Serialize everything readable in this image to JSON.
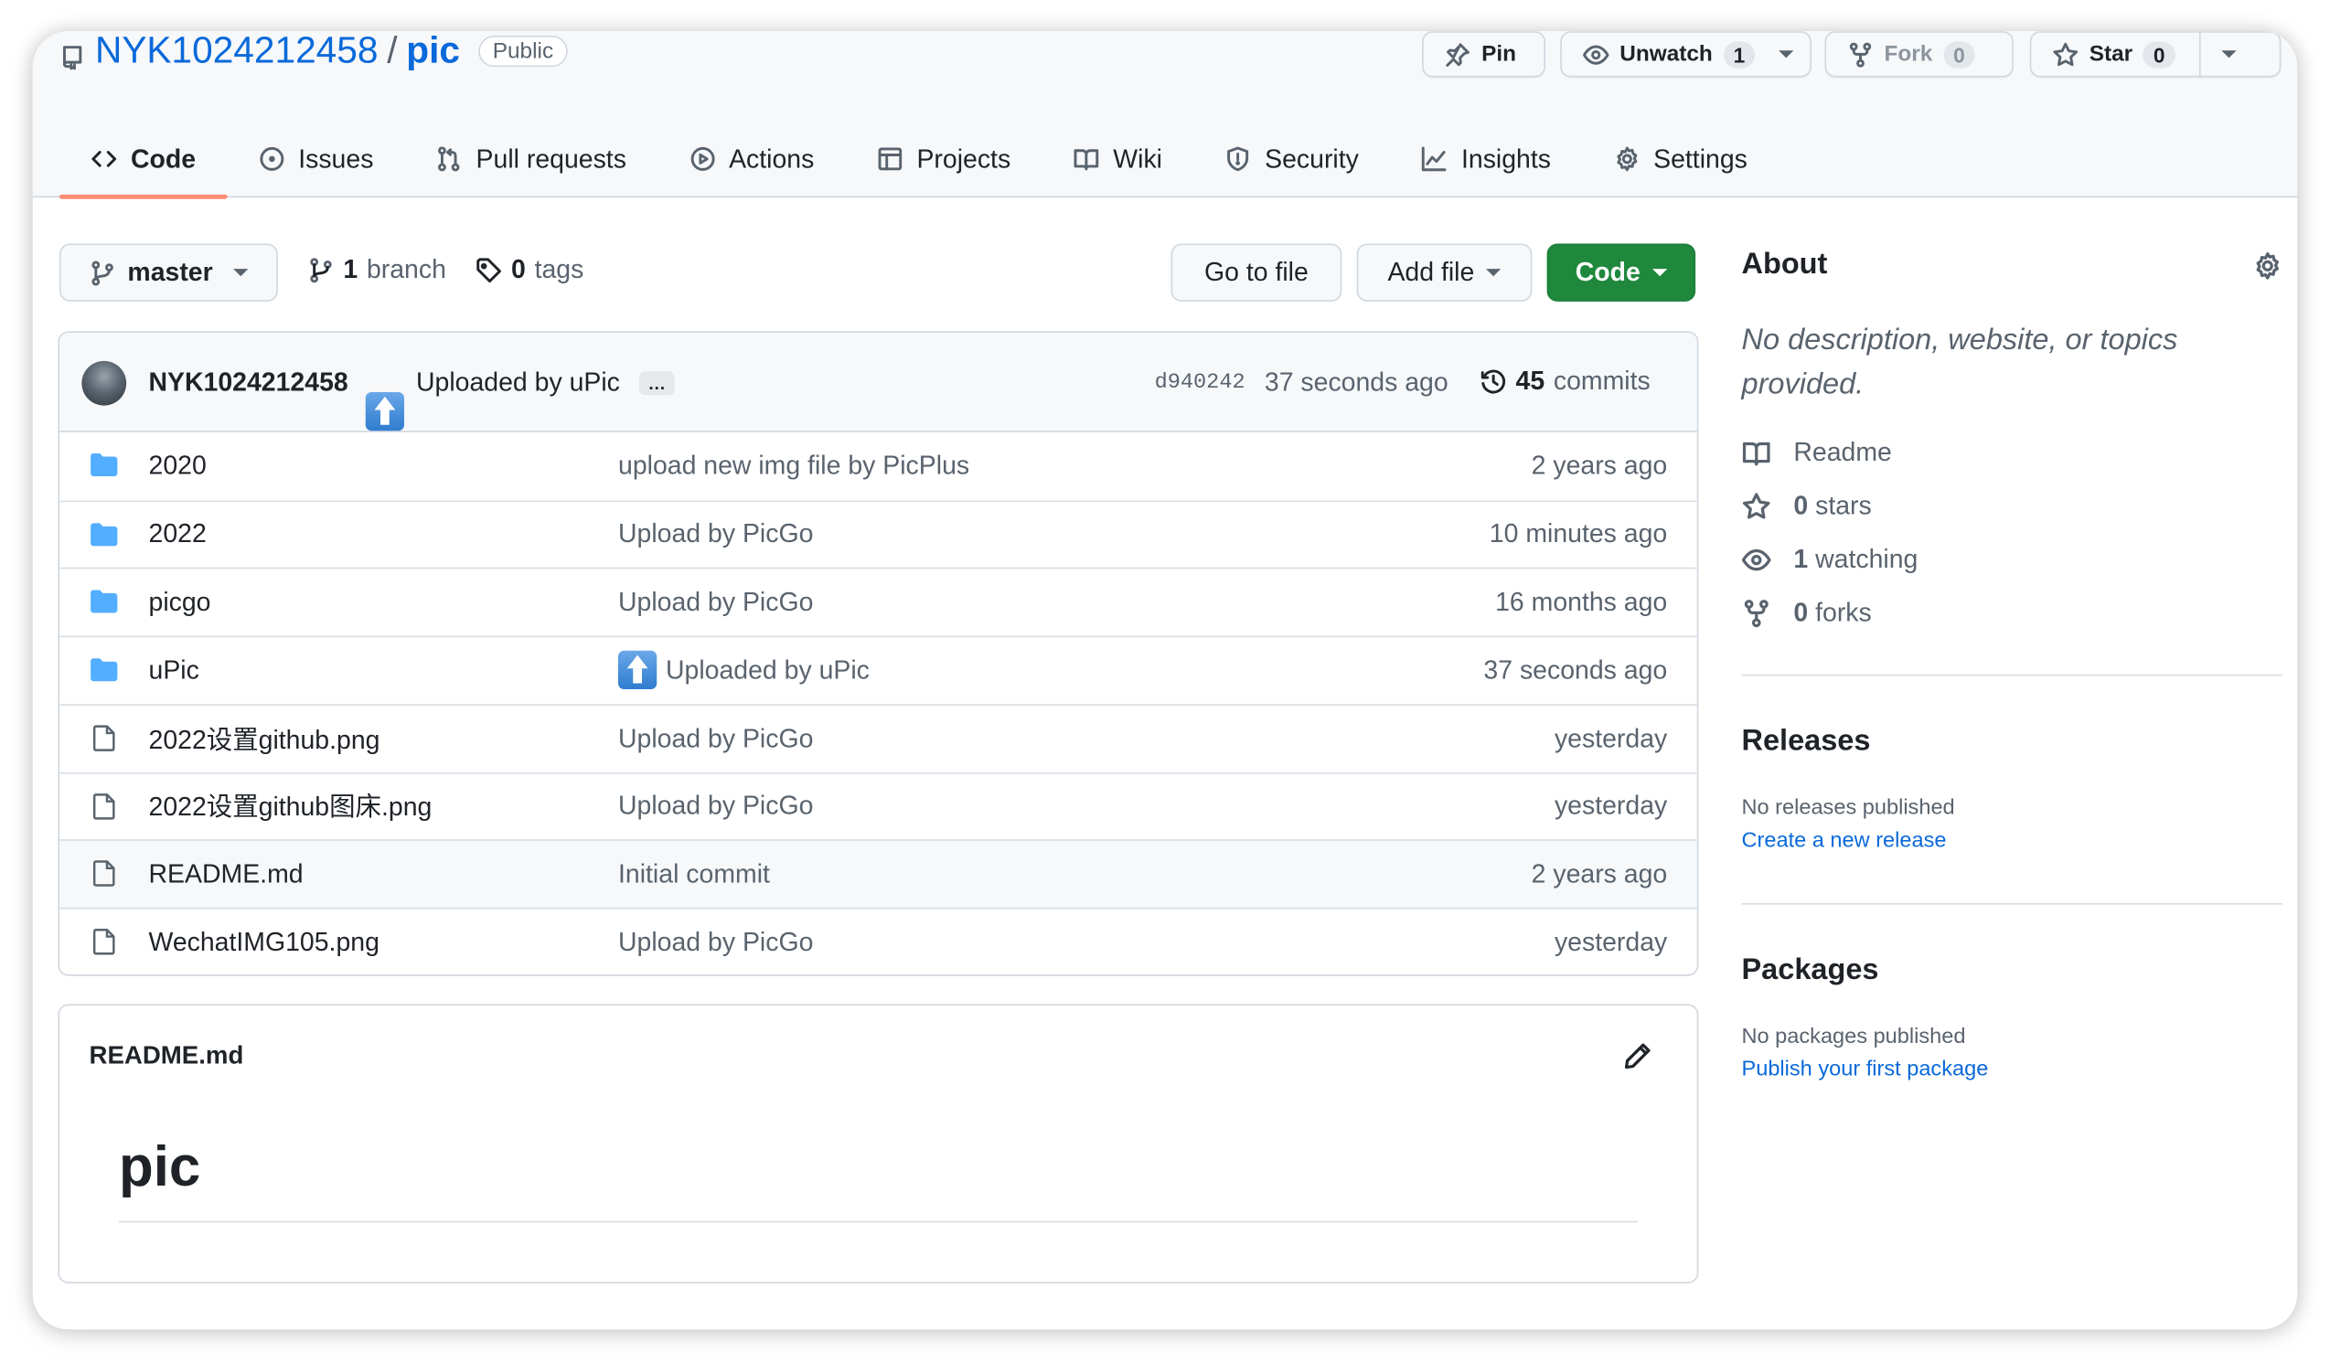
{
  "repo": {
    "owner": "NYK1024212458",
    "separator": "/",
    "name": "pic",
    "visibility": "Public"
  },
  "header_actions": {
    "pin": "Pin",
    "unwatch": {
      "label": "Unwatch",
      "count": "1"
    },
    "fork": {
      "label": "Fork",
      "count": "0"
    },
    "star": {
      "label": "Star",
      "count": "0"
    }
  },
  "tabs": [
    {
      "label": "Code",
      "icon": "code-icon",
      "active": true
    },
    {
      "label": "Issues",
      "icon": "issue-icon"
    },
    {
      "label": "Pull requests",
      "icon": "pull-request-icon"
    },
    {
      "label": "Actions",
      "icon": "play-icon"
    },
    {
      "label": "Projects",
      "icon": "table-icon"
    },
    {
      "label": "Wiki",
      "icon": "book-icon"
    },
    {
      "label": "Security",
      "icon": "shield-icon"
    },
    {
      "label": "Insights",
      "icon": "graph-icon"
    },
    {
      "label": "Settings",
      "icon": "gear-icon"
    }
  ],
  "toolbar": {
    "branch_selector": "master",
    "branches_count": "1",
    "branches_label": "branch",
    "tags_count": "0",
    "tags_label": "tags",
    "go_to_file": "Go to file",
    "add_file": "Add file",
    "code": "Code"
  },
  "latest_commit": {
    "author": "NYK1024212458",
    "message": "Uploaded by uPic",
    "more": "…",
    "sha": "d940242",
    "time": "37 seconds ago",
    "commits_count": "45",
    "commits_label": "commits"
  },
  "files": [
    {
      "type": "folder",
      "name": "2020",
      "message": "upload new img file by PicPlus",
      "age": "2 years ago"
    },
    {
      "type": "folder",
      "name": "2022",
      "message": "Upload by PicGo",
      "age": "10 minutes ago"
    },
    {
      "type": "folder",
      "name": "picgo",
      "message": "Upload by PicGo",
      "age": "16 months ago"
    },
    {
      "type": "folder",
      "name": "uPic",
      "message": "Uploaded by uPic",
      "emoji": "up-arrow",
      "age": "37 seconds ago"
    },
    {
      "type": "file",
      "name": "2022设置github.png",
      "message": "Upload by PicGo",
      "age": "yesterday"
    },
    {
      "type": "file",
      "name": "2022设置github图床.png",
      "message": "Upload by PicGo",
      "age": "yesterday"
    },
    {
      "type": "file",
      "name": "README.md",
      "message": "Initial commit",
      "age": "2 years ago"
    },
    {
      "type": "file",
      "name": "WechatIMG105.png",
      "message": "Upload by PicGo",
      "age": "yesterday"
    }
  ],
  "readme": {
    "filename": "README.md",
    "heading": "pic"
  },
  "about": {
    "title": "About",
    "description": "No description, website, or topics provided.",
    "readme_label": "Readme",
    "stars_count": "0",
    "stars_label": "stars",
    "watching_count": "1",
    "watching_label": "watching",
    "forks_count": "0",
    "forks_label": "forks"
  },
  "releases": {
    "title": "Releases",
    "status": "No releases published",
    "link": "Create a new release"
  },
  "packages": {
    "title": "Packages",
    "status": "No packages published",
    "link": "Publish your first package"
  },
  "colors": {
    "link": "#0969da",
    "primary_button": "#1f883d",
    "active_tab_underline": "#fd8c73",
    "folder": "#54aeff"
  }
}
